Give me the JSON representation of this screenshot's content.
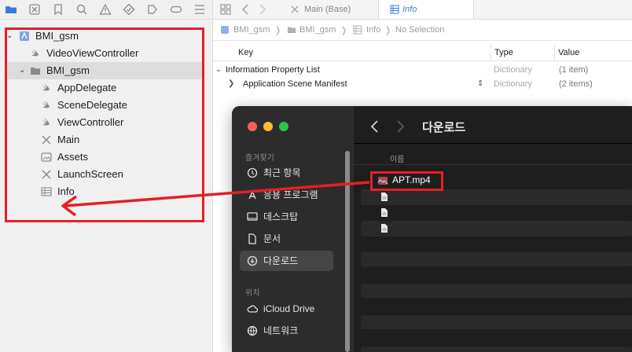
{
  "navigator": {
    "project": "BMI_gsm",
    "items": [
      {
        "label": "VideoViewController"
      },
      {
        "label": "BMI_gsm"
      },
      {
        "label": "AppDelegate"
      },
      {
        "label": "SceneDelegate"
      },
      {
        "label": "ViewController"
      },
      {
        "label": "Main"
      },
      {
        "label": "Assets"
      },
      {
        "label": "LaunchScreen"
      },
      {
        "label": "Info"
      }
    ]
  },
  "editor": {
    "tabs": [
      {
        "label": "Main (Base)"
      },
      {
        "label": "Info"
      }
    ],
    "jumpbar": [
      "BMI_gsm",
      "BMI_gsm",
      "Info",
      "No Selection"
    ],
    "plist": {
      "headers": {
        "key": "Key",
        "type": "Type",
        "value": "Value"
      },
      "rows": [
        {
          "key": "Information Property List",
          "type": "Dictionary",
          "value": "(1 item)"
        },
        {
          "key": "Application Scene Manifest",
          "type": "Dictionary",
          "value": "(2 items)"
        }
      ]
    }
  },
  "finder": {
    "title": "다운로드",
    "sidebar": {
      "section_favorites": "즐겨찾기",
      "favorites": [
        {
          "label": "최근 항목",
          "icon": "clock-icon"
        },
        {
          "label": "응용 프로그램",
          "icon": "apps-icon"
        },
        {
          "label": "데스크탑",
          "icon": "desktop-icon"
        },
        {
          "label": "문서",
          "icon": "document-icon"
        },
        {
          "label": "다운로드",
          "icon": "download-icon"
        }
      ],
      "section_locations": "위치",
      "locations": [
        {
          "label": "iCloud Drive",
          "icon": "cloud-icon"
        },
        {
          "label": "네트워크",
          "icon": "network-icon"
        }
      ]
    },
    "column_header": "이름",
    "files": [
      {
        "name": "APT.mp4",
        "icon": "video-file-icon"
      },
      {
        "name": "",
        "icon": "file-icon"
      },
      {
        "name": "",
        "icon": "file-icon"
      },
      {
        "name": "",
        "icon": "file-icon"
      }
    ]
  },
  "colors": {
    "annotation_red": "#e32025",
    "finder_bg": "#1e1e1e",
    "finder_sidebar": "#2d2c2c",
    "accent_blue": "#3a7bd5"
  }
}
